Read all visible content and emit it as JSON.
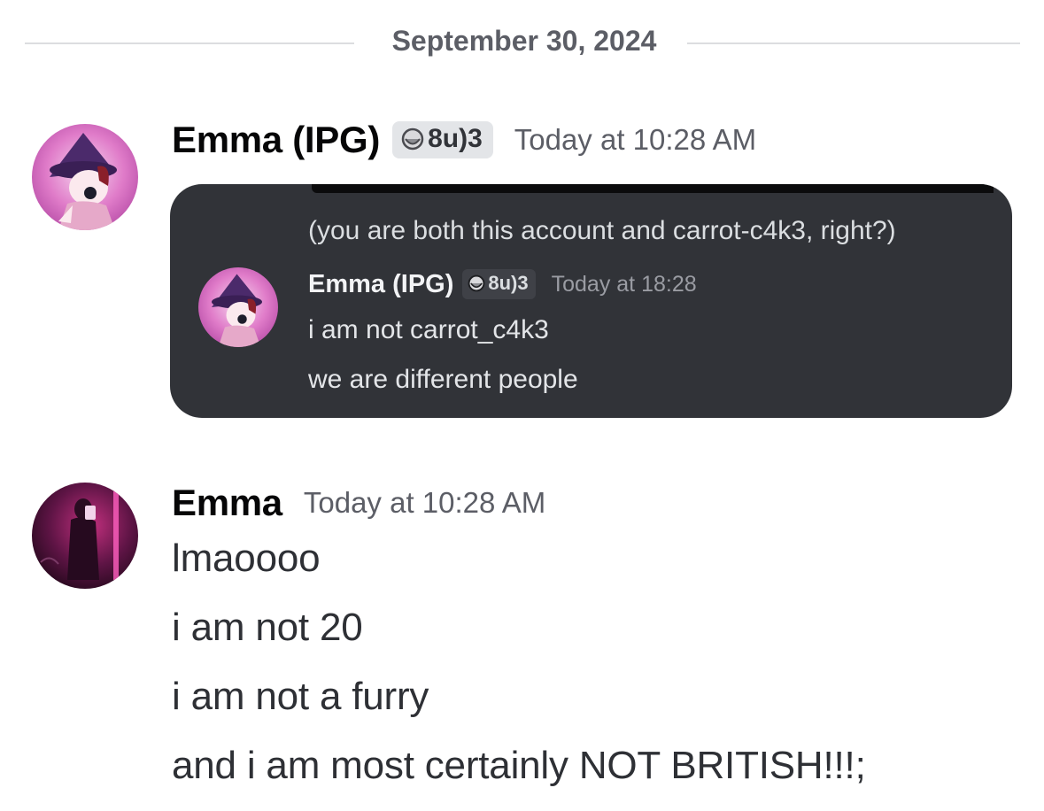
{
  "date_divider": "September 30, 2024",
  "message1": {
    "username": "Emma (IPG)",
    "tag": "8u)3",
    "timestamp": "Today at 10:28 AM",
    "embed": {
      "context_text": "(you are both this account and carrot-c4k3, right?)",
      "username": "Emma (IPG)",
      "tag": "8u)3",
      "timestamp": "Today at 18:28",
      "lines": [
        "i am not carrot_c4k3",
        "we are different people"
      ]
    }
  },
  "message2": {
    "username": "Emma",
    "timestamp": "Today at 10:28 AM",
    "lines": [
      "lmaoooo",
      "i am not 20",
      "i am not a furry",
      "and i am most certainly NOT BRITISH!!!;"
    ]
  },
  "colors": {
    "embed_background": "#313338",
    "tag_background": "#e3e5e8",
    "divider_line": "#dcdde0"
  },
  "icons": {
    "tag_icon": "clan-badge-icon"
  }
}
